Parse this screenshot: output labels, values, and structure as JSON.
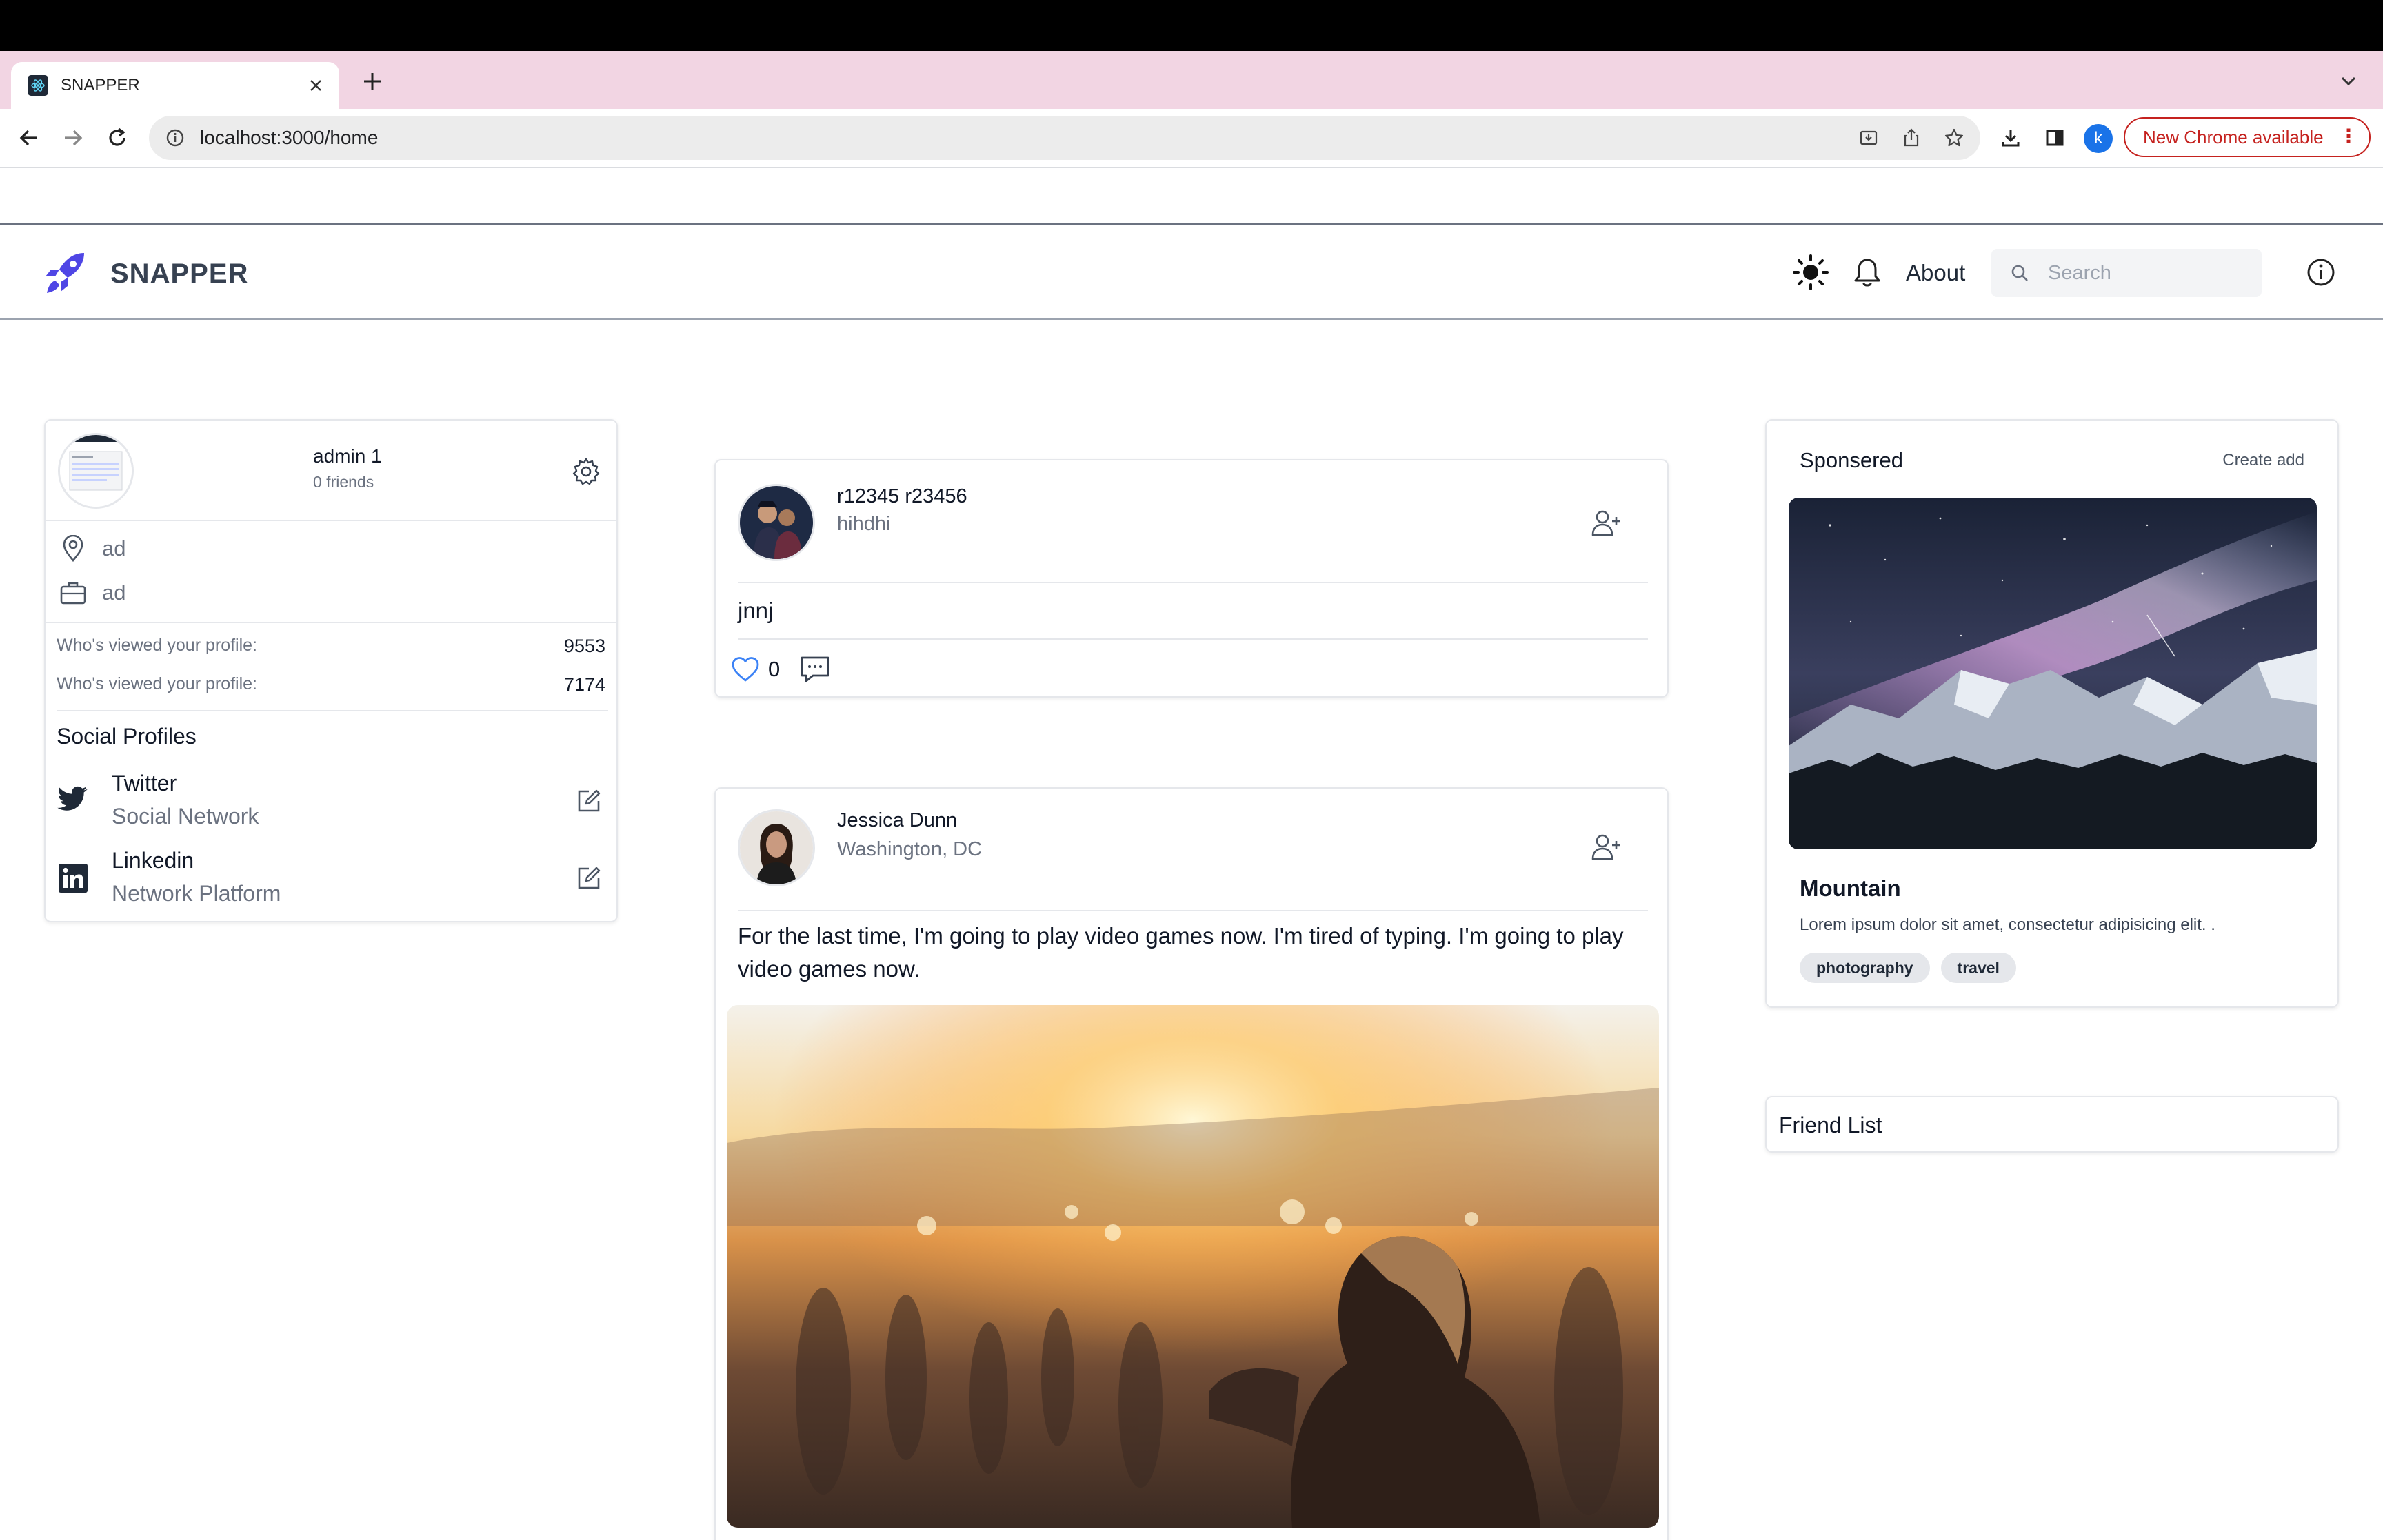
{
  "browser": {
    "tab_title": "SNAPPER",
    "url": "localhost:3000/home",
    "profile_initial": "k",
    "update_label": "New Chrome available"
  },
  "header": {
    "brand": "SNAPPER",
    "about_label": "About",
    "search_placeholder": "Search"
  },
  "profile": {
    "name": "admin 1",
    "friends": "0 friends",
    "location": "ad",
    "occupation": "ad",
    "stats": [
      {
        "label": "Who's viewed your profile:",
        "value": "9553"
      },
      {
        "label": "Who's viewed your profile:",
        "value": "7174"
      }
    ],
    "social_title": "Social Profiles",
    "socials": [
      {
        "name": "Twitter",
        "sub": "Social Network",
        "icon": "twitter-icon"
      },
      {
        "name": "Linkedin",
        "sub": "Network Platform",
        "icon": "linkedin-icon"
      }
    ]
  },
  "posts": [
    {
      "name": "r12345 r23456",
      "location": "hihdhi",
      "text": "jnnj",
      "likes": "0"
    },
    {
      "name": "Jessica Dunn",
      "location": "Washington, DC",
      "text": "For the last time, I'm going to play video games now. I'm tired of typing. I'm going to play video games now."
    }
  ],
  "sponsored": {
    "title": "Sponsered",
    "create_label": "Create add",
    "ad_name": "Mountain",
    "ad_desc": "Lorem ipsum dolor sit amet, consectetur adipisicing elit. .",
    "tags": [
      "photography",
      "travel"
    ]
  },
  "friend_list": {
    "title": "Friend List"
  },
  "colors": {
    "tab_strip": "#f2d5e3",
    "brand_accent": "#4f46e5",
    "update_red": "#c5221f",
    "like_blue": "#3b82f6"
  }
}
